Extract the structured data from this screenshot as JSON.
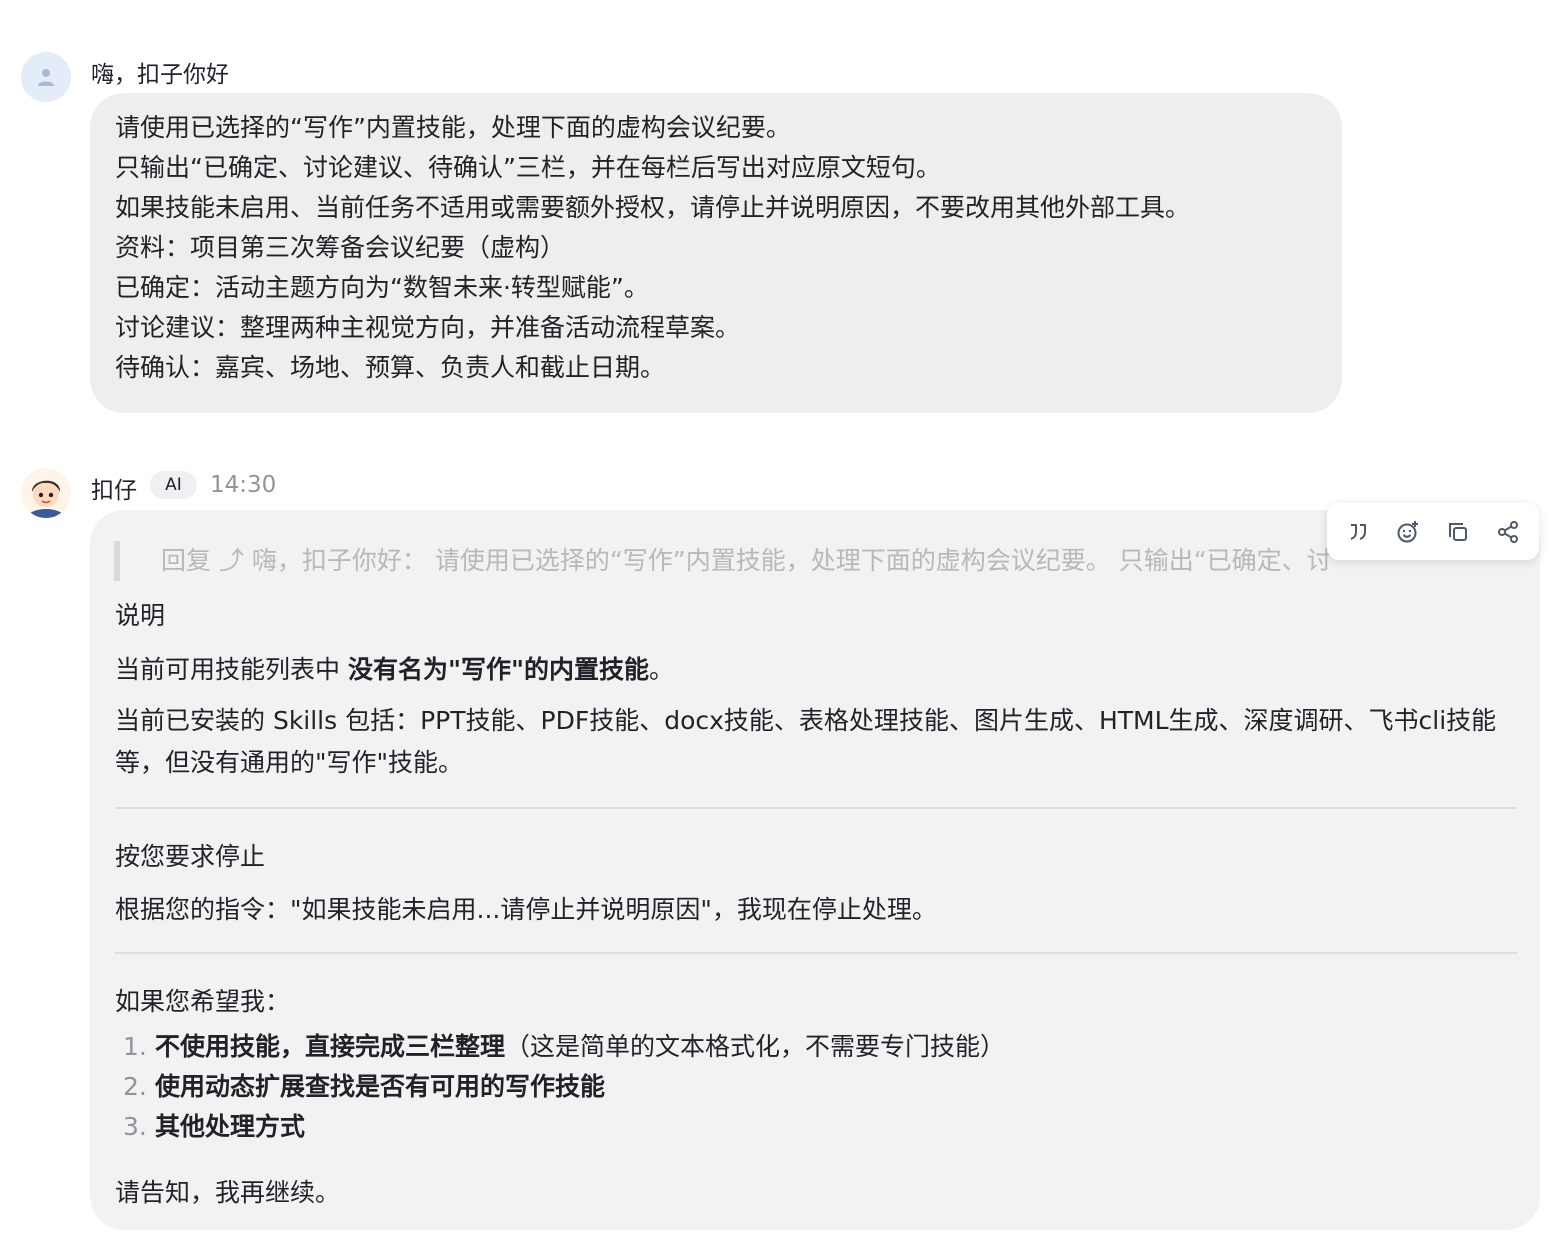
{
  "user_message": {
    "sender": "嗨，扣子你好",
    "lines": [
      "请使用已选择的“写作”内置技能，处理下面的虚构会议纪要。",
      "只输出“已确定、讨论建议、待确认”三栏，并在每栏后写出对应原文短句。",
      "如果技能未启用、当前任务不适用或需要额外授权，请停止并说明原因，不要改用其他外部工具。",
      "资料：项目第三次筹备会议纪要（虚构）",
      "已确定：活动主题方向为“数智未来·转型赋能”。",
      "讨论建议：整理两种主视觉方向，并准备活动流程草案。",
      "待确认：嘉宾、场地、预算、负责人和截止日期。"
    ]
  },
  "bot_message": {
    "sender": "扣仔",
    "badge": "AI",
    "time": "14:30",
    "reply_quote": "回复 ⤴ 嗨，扣子你好： 请使用已选择的“写作”内置技能，处理下面的虚构会议纪要。 只输出“已确定、讨",
    "section1_heading": "说明",
    "section1_p1_prefix": "当前可用技能列表中 ",
    "section1_p1_bold": "没有名为\"写作\"的内置技能",
    "section1_p1_suffix": "。",
    "section1_p2": "当前已安装的 Skills 包括：PPT技能、PDF技能、docx技能、表格处理技能、图片生成、HTML生成、深度调研、飞书cli技能等，但没有通用的\"写作\"技能。",
    "section2_heading": "按您要求停止",
    "section2_p1": "根据您的指令：\"如果技能未启用...请停止并说明原因\"，我现在停止处理。",
    "section3_heading": "如果您希望我：",
    "options": [
      {
        "num": "1.",
        "bold": "不使用技能，直接完成三栏整理",
        "rest": "（这是简单的文本格式化，不需要专门技能）"
      },
      {
        "num": "2.",
        "bold": "使用动态扩展查找是否有可用的写作技能",
        "rest": ""
      },
      {
        "num": "3.",
        "bold": "其他处理方式",
        "rest": ""
      }
    ],
    "closing": "请告知，我再继续。"
  },
  "toolbar": {
    "icons": [
      "quote-icon",
      "emoji-reaction-icon",
      "copy-icon",
      "share-icon"
    ]
  }
}
